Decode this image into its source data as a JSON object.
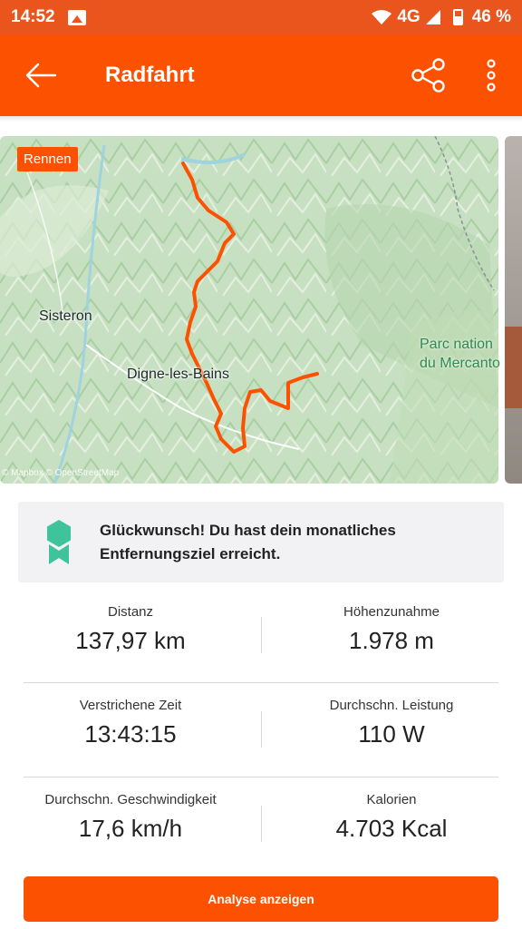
{
  "status_bar": {
    "time": "14:52",
    "network": "4G",
    "battery": "46 %"
  },
  "app_bar": {
    "title": "Radfahrt"
  },
  "map": {
    "tag": "Rennen",
    "places": [
      "Sisteron",
      "Digne-les-Bains"
    ],
    "park_line1": "Parc nation",
    "park_line2": "du Mercanto",
    "attribution": "© Mapbox © OpenStreetMap",
    "route_color": "#fc5200"
  },
  "goal": {
    "message": "Glückwunsch! Du hast dein monatliches Entfernungsziel erreicht.",
    "badge_color": "#3fc39a"
  },
  "stats": [
    {
      "label": "Distanz",
      "value": "137,97 km"
    },
    {
      "label": "Höhenzunahme",
      "value": "1.978 m"
    },
    {
      "label": "Verstrichene Zeit",
      "value": "13:43:15"
    },
    {
      "label": "Durchschn. Leistung",
      "value": "110 W"
    },
    {
      "label": "Durchschn. Geschwindigkeit",
      "value": "17,6 km/h"
    },
    {
      "label": "Kalorien",
      "value": "4.703 Kcal"
    }
  ],
  "cta": {
    "label": "Analyse anzeigen"
  },
  "accent": "#fc5200"
}
